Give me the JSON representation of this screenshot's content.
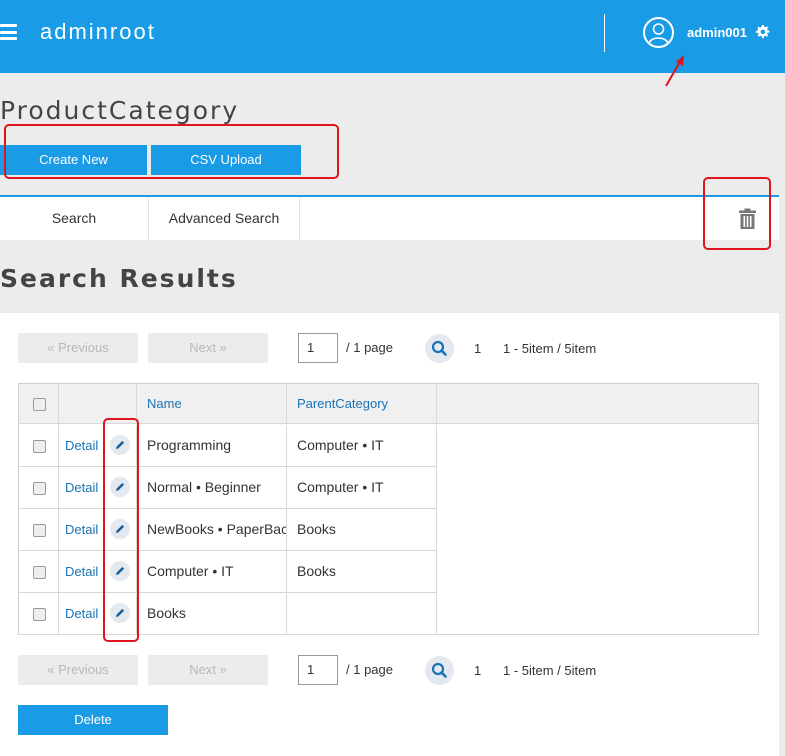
{
  "header": {
    "app_title": "adminroot",
    "user_name": "admin001",
    "menu_icon": "hamburger-menu-icon",
    "avatar_icon": "user-avatar-icon",
    "settings_icon": "gear-icon",
    "brand_color": "#1a9be6"
  },
  "page": {
    "title": "ProductCategory",
    "create_new_label": "Create New",
    "csv_upload_label": "CSV Upload"
  },
  "tabs": [
    {
      "label": "Search"
    },
    {
      "label": "Advanced Search"
    }
  ],
  "trash_icon": "trash-icon",
  "results": {
    "title": "Search Results",
    "pager": {
      "previous_label": "«  Previous",
      "next_label": "Next  »",
      "page_value": "1",
      "page_suffix": "/  1 page",
      "current_page": "1",
      "range_text": "1 - 5item / 5item"
    },
    "columns": {
      "name": "Name",
      "parent": "ParentCategory"
    },
    "detail_label": "Detail",
    "rows": [
      {
        "name": "Programming",
        "parent": "Computer • IT"
      },
      {
        "name": "Normal • Beginner",
        "parent": "Computer • IT"
      },
      {
        "name": "NewBooks • PaperBack",
        "parent": "Books"
      },
      {
        "name": "Computer • IT",
        "parent": "Books"
      },
      {
        "name": "Books",
        "parent": ""
      }
    ],
    "delete_label": "Delete"
  }
}
